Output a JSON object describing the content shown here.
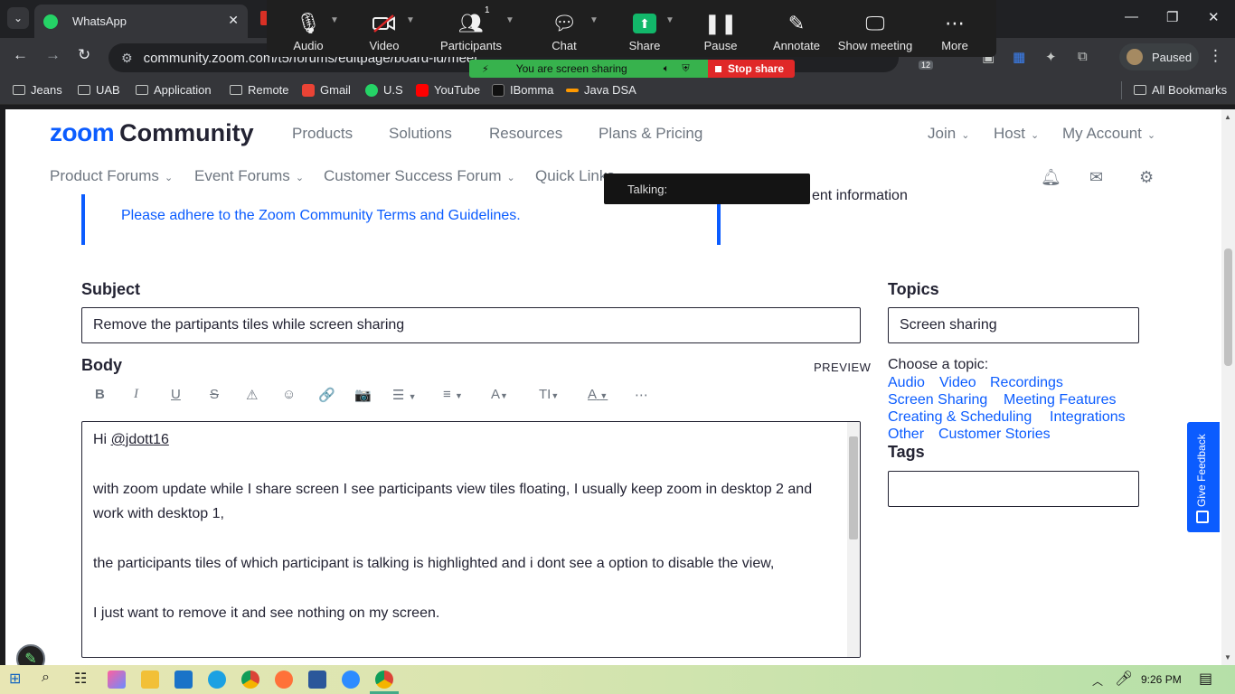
{
  "browser": {
    "tab_title": "WhatsApp",
    "tab_close": "✕",
    "url": "community.zoom.com/t5/forums/editpage/board-id/meet",
    "extension_badge": "12",
    "profile_label": "Paused",
    "window_controls": [
      "—",
      "❐",
      "✕"
    ]
  },
  "bookmarks": [
    {
      "label": "Jeans",
      "icon": "folder-icon"
    },
    {
      "label": "UAB",
      "icon": "folder-icon"
    },
    {
      "label": "Application",
      "icon": "folder-icon"
    },
    {
      "label": "Remote",
      "icon": "folder-icon"
    },
    {
      "label": "Gmail",
      "icon": "gmail-icon",
      "color": "#ea4335"
    },
    {
      "label": "U.S",
      "icon": "whatsapp-icon",
      "color": "#25d366"
    },
    {
      "label": "YouTube",
      "icon": "youtube-icon",
      "color": "#ff0000"
    },
    {
      "label": "IBomma",
      "icon": "ibomma-icon",
      "color": "#111111"
    },
    {
      "label": "Java DSA",
      "icon": "amazon-icon",
      "color": "#ff9900"
    }
  ],
  "all_bookmarks": "All Bookmarks",
  "zoom_toolbar": {
    "items": [
      {
        "label": "Audio",
        "icon": "microphone-icon"
      },
      {
        "label": "Video",
        "icon": "video-off-icon"
      },
      {
        "label": "Participants",
        "icon": "participants-icon"
      },
      {
        "label": "Chat",
        "icon": "chat-icon"
      },
      {
        "label": "Share",
        "icon": "share-screen-icon"
      },
      {
        "label": "Pause",
        "icon": "pause-icon"
      },
      {
        "label": "Annotate",
        "icon": "pencil-icon"
      },
      {
        "label": "Show meeting",
        "icon": "show-meeting-icon"
      },
      {
        "label": "More",
        "icon": "more-icon"
      }
    ],
    "participant_count": "1",
    "sharing_status": "You are screen sharing",
    "stop_share": "Stop share",
    "talking": "Talking:",
    "share_color": "#12b76a",
    "stop_color": "#e02828"
  },
  "site": {
    "logo_zoom": "zoom",
    "logo_community": "Community",
    "main_nav": [
      "Products",
      "Solutions",
      "Resources",
      "Plans & Pricing"
    ],
    "right_nav": [
      "Join",
      "Host",
      "My Account"
    ],
    "sub_nav": [
      "Product Forums",
      "Event Forums",
      "Customer Success Forum",
      "Quick Links"
    ],
    "notice_link": "Please adhere to the Zoom Community Terms and Guidelines.",
    "notice_right": "ent information",
    "brand_color": "#0b5cff"
  },
  "form": {
    "subject_label": "Subject",
    "subject_value": "Remove the partipants tiles while screen sharing",
    "topics_label": "Topics",
    "topics_value": "Screen sharing",
    "body_label": "Body",
    "preview": "PREVIEW",
    "tags_label": "Tags",
    "choose_topic": "Choose a topic:",
    "topic_options": [
      "Audio",
      "Video",
      "Recordings",
      "Screen Sharing",
      "Meeting Features",
      "Creating & Scheduling",
      "Integrations",
      "Other",
      "Customer Stories"
    ],
    "body": {
      "greeting": "Hi ",
      "mention": "@jdott16",
      "para1": "with zoom update while I share screen I see participants view tiles floating, I usually keep zoom in desktop 2 and work with desktop 1,",
      "para2": "the participants tiles of which participant is talking is highlighted and i dont see a option to disable the view,",
      "para3": "I just want to remove it and see nothing on my screen."
    }
  },
  "editor_toolbar": [
    "B",
    "I",
    "U",
    "S",
    "⚠",
    "☺",
    "🔗",
    "📷",
    "☰",
    "≡",
    "A",
    "TI",
    "A",
    "⋯"
  ],
  "feedback_tab": "Give Feedback",
  "taskbar": {
    "time": "9:26 PM"
  }
}
